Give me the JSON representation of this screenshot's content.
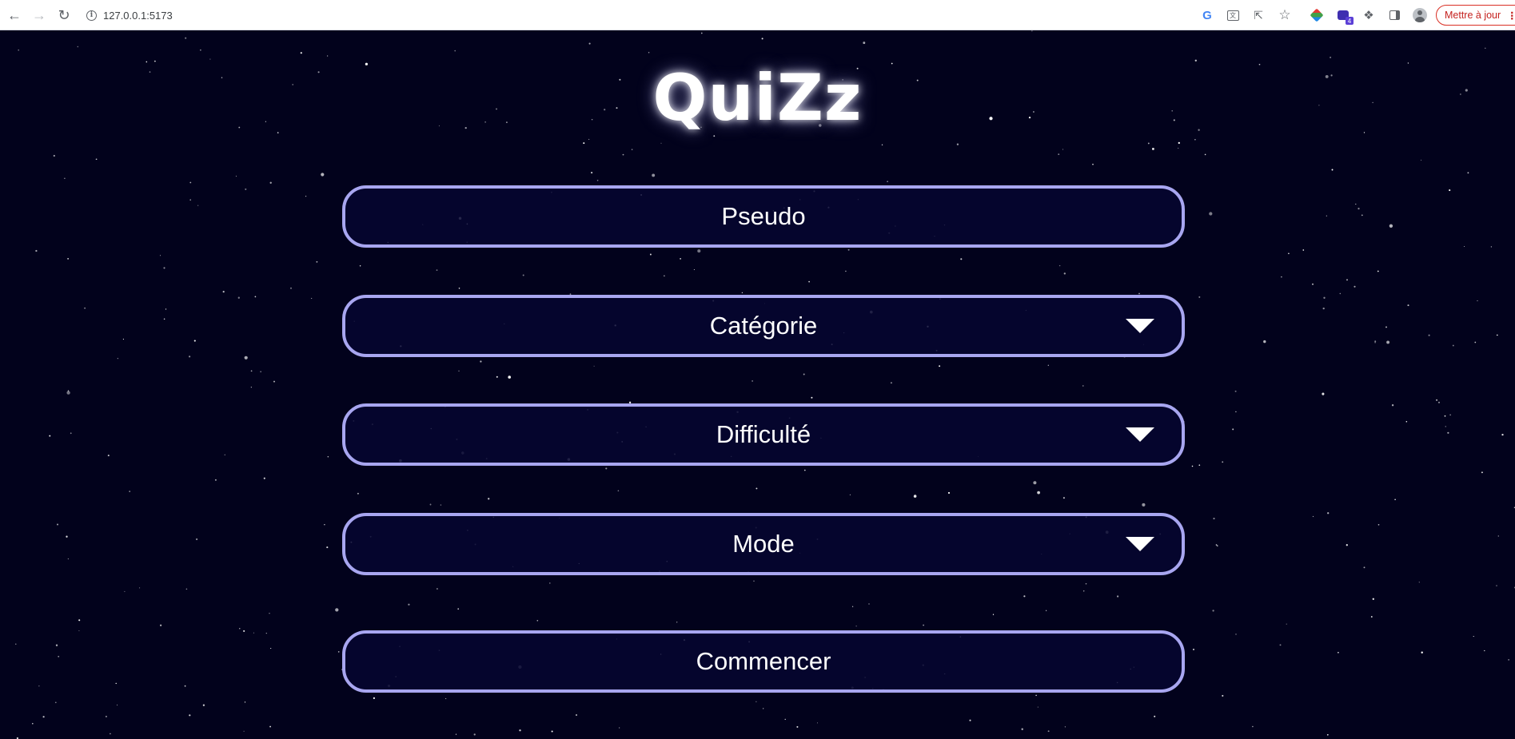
{
  "browser": {
    "url": "127.0.0.1:5173",
    "update_label": "Mettre à jour",
    "icons": [
      "back-arrow",
      "forward-arrow",
      "reload",
      "info",
      "google",
      "translate",
      "share",
      "bookmark-star",
      "extension-color",
      "extension-purple",
      "extensions-puzzle",
      "side-panel",
      "profile"
    ]
  },
  "app": {
    "title": "QuiZz",
    "pseudo_label": "Pseudo",
    "category_label": "Catégorie",
    "difficulty_label": "Difficulté",
    "mode_label": "Mode",
    "start_label": "Commencer"
  },
  "colors": {
    "background": "#02021c",
    "field_border": "#a8a6f0",
    "text": "#ffffff"
  }
}
